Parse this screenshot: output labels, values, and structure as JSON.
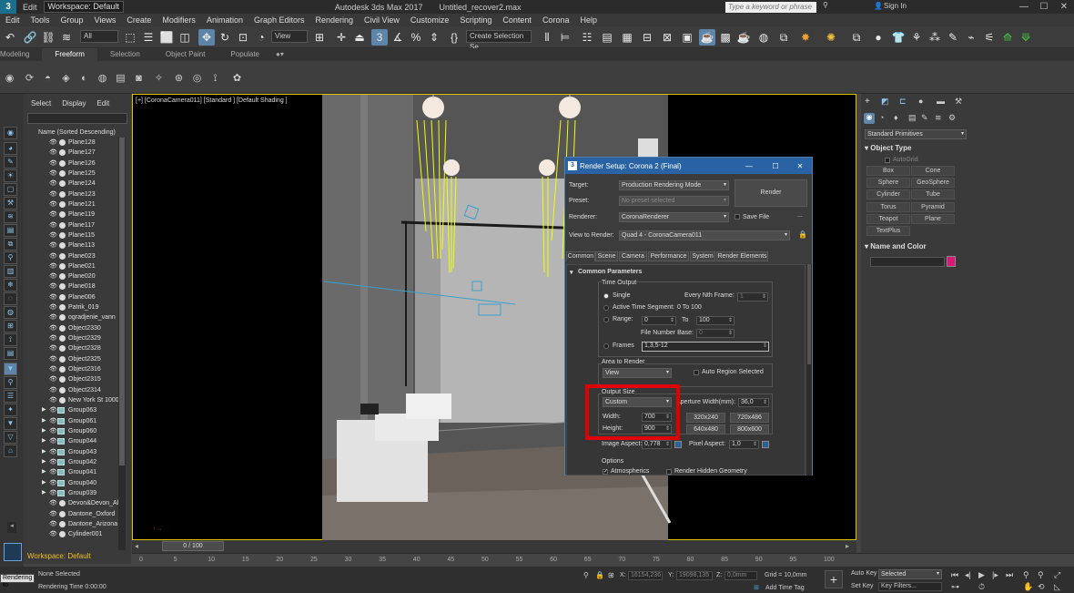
{
  "app": {
    "logo": "3",
    "title": "Autodesk 3ds Max 2017",
    "file": "Untitled_recover2.max",
    "workspace": "Workspace: Default",
    "search_placeholder": "Type a keyword or phrase",
    "sign_in": "Sign In"
  },
  "menu": [
    "Edit",
    "Tools",
    "Group",
    "Views",
    "Create",
    "Modifiers",
    "Animation",
    "Graph Editors",
    "Rendering",
    "Civil View",
    "Customize",
    "Scripting",
    "Content",
    "Corona",
    "Help"
  ],
  "toolbar": {
    "filter": "All",
    "view": "View",
    "selection_set": "Create Selection Se"
  },
  "ribbon": {
    "tabs": [
      "Modeling",
      "Freeform",
      "Selection",
      "Object Paint",
      "Populate"
    ],
    "active": "Freeform"
  },
  "explorer": {
    "tabs": [
      "Select",
      "Display",
      "Edit"
    ],
    "header": "Name (Sorted Descending)",
    "items": [
      {
        "n": "Plane128",
        "g": false
      },
      {
        "n": "Plane127",
        "g": false
      },
      {
        "n": "Plane126",
        "g": false
      },
      {
        "n": "Plane125",
        "g": false
      },
      {
        "n": "Plane124",
        "g": false
      },
      {
        "n": "Plane123",
        "g": false
      },
      {
        "n": "Plane121",
        "g": false
      },
      {
        "n": "Plane119",
        "g": false
      },
      {
        "n": "Plane117",
        "g": false
      },
      {
        "n": "Plane115",
        "g": false
      },
      {
        "n": "Plane113",
        "g": false
      },
      {
        "n": "Plane023",
        "g": false
      },
      {
        "n": "Plane021",
        "g": false
      },
      {
        "n": "Plane020",
        "g": false
      },
      {
        "n": "Plane018",
        "g": false
      },
      {
        "n": "Plane006",
        "g": false
      },
      {
        "n": "Patrik_019",
        "g": false
      },
      {
        "n": "ogradjenie_vann",
        "g": false
      },
      {
        "n": "Object2330",
        "g": false
      },
      {
        "n": "Object2329",
        "g": false
      },
      {
        "n": "Object2328",
        "g": false
      },
      {
        "n": "Object2325",
        "g": false
      },
      {
        "n": "Object2316",
        "g": false
      },
      {
        "n": "Object2315",
        "g": false
      },
      {
        "n": "Object2314",
        "g": false
      },
      {
        "n": "New York St 1000",
        "g": false
      },
      {
        "n": "Group063",
        "g": true
      },
      {
        "n": "Group061",
        "g": true
      },
      {
        "n": "Group060",
        "g": true
      },
      {
        "n": "Group044",
        "g": true
      },
      {
        "n": "Group043",
        "g": true
      },
      {
        "n": "Group042",
        "g": true
      },
      {
        "n": "Group041",
        "g": true
      },
      {
        "n": "Group040",
        "g": true
      },
      {
        "n": "Group039",
        "g": true
      },
      {
        "n": "Devon&Devon_All",
        "g": false
      },
      {
        "n": "Dantone_Oxford",
        "g": false
      },
      {
        "n": "Dantone_Arizona",
        "g": false
      },
      {
        "n": "Cylinder001",
        "g": false
      }
    ]
  },
  "viewport": {
    "label": "[+] [CoronaCamera011] [Standard ] [Default Shading ]"
  },
  "command_panel": {
    "dropdown": "Standard Primitives",
    "object_type": "Object Type",
    "autogrid": "AutoGrid",
    "buttons": [
      "Box",
      "Cone",
      "Sphere",
      "GeoSphere",
      "Cylinder",
      "Tube",
      "Torus",
      "Pyramid",
      "Teapot",
      "Plane",
      "TextPlus"
    ],
    "name_color": "Name and Color",
    "color": "#e0157a"
  },
  "dialog": {
    "title": "Render Setup: Corona 2 (Final)",
    "target_label": "Target:",
    "target": "Production Rendering Mode",
    "preset_label": "Preset:",
    "preset": "No preset selected",
    "renderer_label": "Renderer:",
    "renderer": "CoronaRenderer",
    "save_file": "Save File",
    "view_label": "View to Render:",
    "view": "Quad 4 - CoronaCamera011",
    "render_btn": "Render",
    "tabs": [
      "Common",
      "Scene",
      "Camera",
      "Performance",
      "System",
      "Render Elements"
    ],
    "rollout": "Common Parameters",
    "time_output": "Time Output",
    "single": "Single",
    "every_nth": "Every Nth Frame:",
    "every_nth_val": "1",
    "active_segment": "Active Time Segment:",
    "segment_val": "0 To 100",
    "range": "Range:",
    "range_from": "0",
    "range_to_label": "To",
    "range_to": "100",
    "file_number_base": "File Number Base:",
    "file_number_val": "0",
    "frames": "Frames",
    "frames_val": "1,3,5-12",
    "area": "Area to Render",
    "area_val": "View",
    "auto_region": "Auto Region Selected",
    "output_size": "Output Size",
    "output_size_val": "Custom",
    "aperture": "Aperture Width(mm):",
    "aperture_val": "36,0",
    "width_label": "Width:",
    "width": "700",
    "height_label": "Height:",
    "height": "900",
    "presets": [
      "320x240",
      "720x486",
      "640x480",
      "800x600"
    ],
    "image_aspect": "Image Aspect:",
    "image_aspect_val": "0,778",
    "pixel_aspect": "Pixel Aspect:",
    "pixel_aspect_val": "1,0",
    "options": "Options",
    "atmospherics": "Atmospherics",
    "hidden_geo": "Render Hidden Geometry"
  },
  "timeline": {
    "frame": "0 / 100",
    "ticks": [
      "0",
      "5",
      "10",
      "15",
      "20",
      "25",
      "30",
      "35",
      "40",
      "45",
      "50",
      "55",
      "60",
      "65",
      "70",
      "75",
      "80",
      "85",
      "90",
      "95",
      "100"
    ]
  },
  "status": {
    "selection": "None Selected",
    "render_time": "Rendering Time  0:00:00",
    "maxscript": "Rendering to",
    "x_label": "X:",
    "x": "16154,236",
    "y_label": "Y:",
    "y": "19098,135",
    "z_label": "Z:",
    "z": "0,0mm",
    "grid": "Grid = 10,0mm",
    "add_time_tag": "Add Time Tag",
    "auto_key": "Auto Key",
    "set_key": "Set Key",
    "selected": "Selected",
    "key_filters": "Key Filters..."
  },
  "workspace_bar": "Workspace: Default"
}
